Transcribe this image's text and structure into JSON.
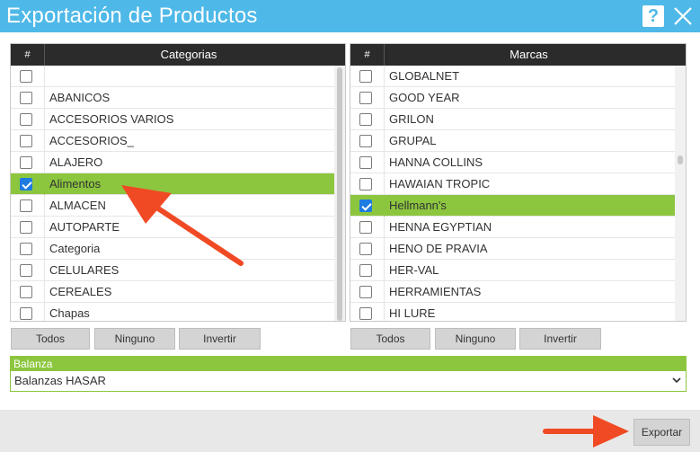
{
  "window": {
    "title": "Exportación de Productos",
    "help_label": "?"
  },
  "categorias": {
    "hash": "#",
    "header": "Categorias",
    "items": [
      {
        "label": "",
        "checked": false
      },
      {
        "label": "ABANICOS",
        "checked": false
      },
      {
        "label": "ACCESORIOS VARIOS",
        "checked": false
      },
      {
        "label": "ACCESORIOS_",
        "checked": false
      },
      {
        "label": "ALAJERO",
        "checked": false
      },
      {
        "label": "Alimentos",
        "checked": true
      },
      {
        "label": "ALMACEN",
        "checked": false
      },
      {
        "label": "AUTOPARTE",
        "checked": false
      },
      {
        "label": "Categoria",
        "checked": false
      },
      {
        "label": "CELULARES",
        "checked": false
      },
      {
        "label": "CEREALES",
        "checked": false
      },
      {
        "label": "Chapas",
        "checked": false
      }
    ],
    "buttons": {
      "todos": "Todos",
      "ninguno": "Ninguno",
      "invertir": "Invertir"
    }
  },
  "marcas": {
    "hash": "#",
    "header": "Marcas",
    "items": [
      {
        "label": "GLOBALNET",
        "checked": false
      },
      {
        "label": "GOOD YEAR",
        "checked": false
      },
      {
        "label": "GRILON",
        "checked": false
      },
      {
        "label": "GRUPAL",
        "checked": false
      },
      {
        "label": "HANNA COLLINS",
        "checked": false
      },
      {
        "label": "HAWAIAN TROPIC",
        "checked": false
      },
      {
        "label": "Hellmann's",
        "checked": true
      },
      {
        "label": "HENNA EGYPTIAN",
        "checked": false
      },
      {
        "label": "HENO DE PRAVIA",
        "checked": false
      },
      {
        "label": "HER-VAL",
        "checked": false
      },
      {
        "label": "HERRAMIENTAS",
        "checked": false
      },
      {
        "label": "HI LURE",
        "checked": false
      }
    ],
    "buttons": {
      "todos": "Todos",
      "ninguno": "Ninguno",
      "invertir": "Invertir"
    }
  },
  "balanza": {
    "label": "Balanza",
    "selected": "Balanzas HASAR"
  },
  "footer": {
    "export_label": "Exportar"
  },
  "colors": {
    "titlebar": "#4eb9e8",
    "selection": "#8cc63f",
    "arrow": "#f04a24"
  }
}
